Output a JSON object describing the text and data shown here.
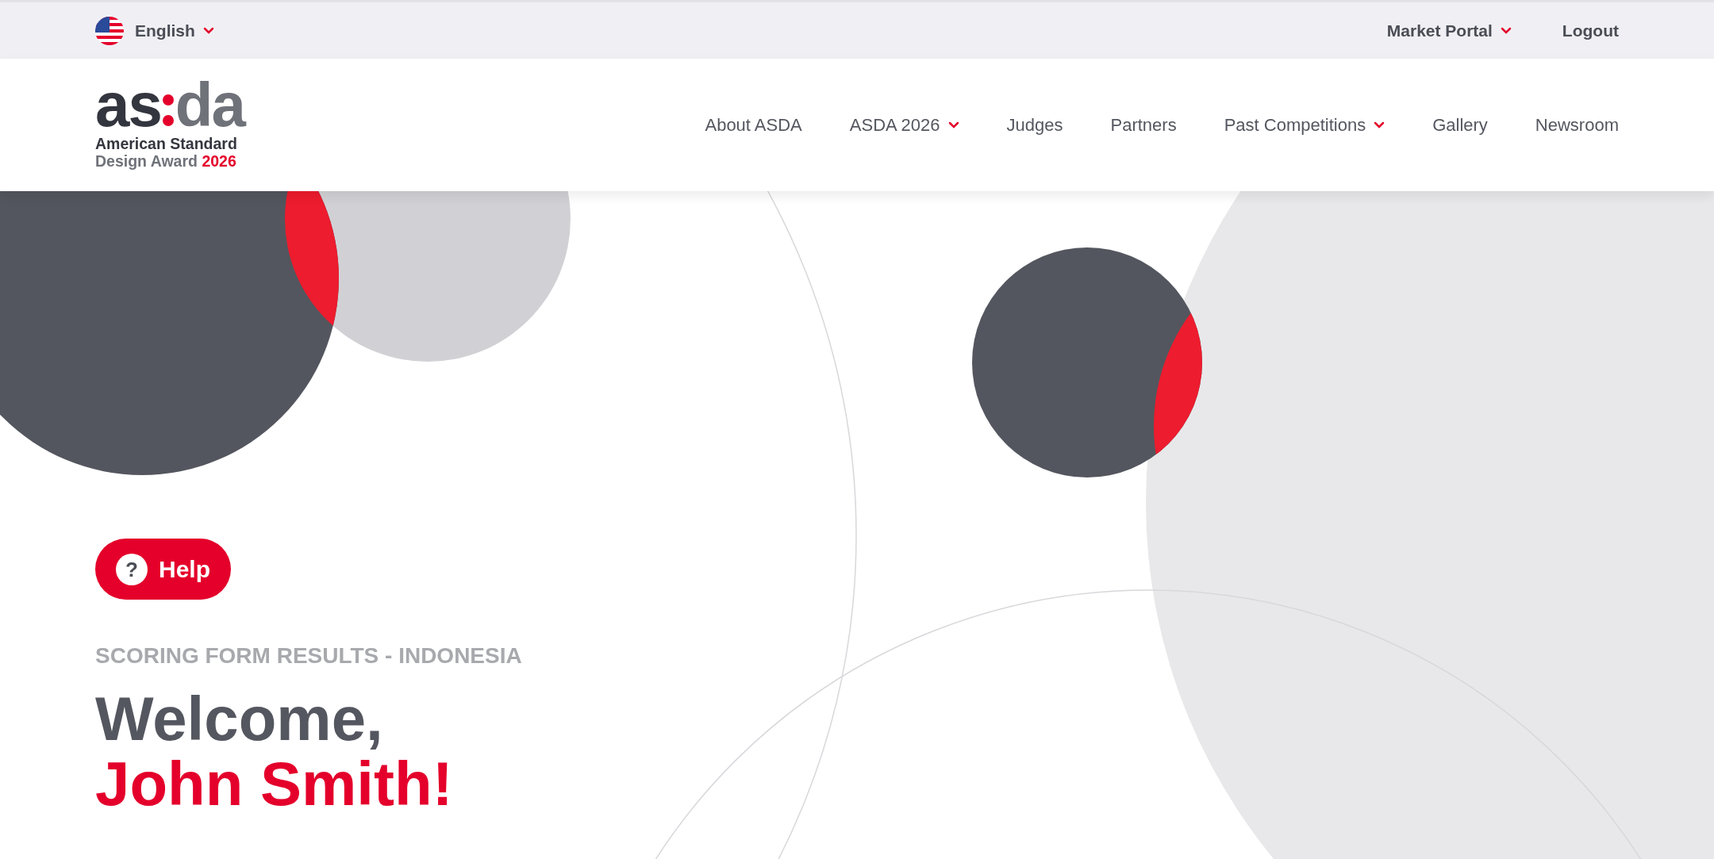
{
  "top_bar": {
    "language": {
      "label": "English",
      "dropdown": true
    },
    "links": [
      {
        "label": "Market Portal",
        "dropdown": true
      },
      {
        "label": "Logout",
        "dropdown": false
      }
    ]
  },
  "logo": {
    "mark_left": "as",
    "mark_right": "da",
    "line1": "American Standard",
    "line2": "Design Award",
    "year": "2026"
  },
  "nav": [
    {
      "label": "About ASDA",
      "dropdown": false
    },
    {
      "label": "ASDA 2026",
      "dropdown": true
    },
    {
      "label": "Judges",
      "dropdown": false
    },
    {
      "label": "Partners",
      "dropdown": false
    },
    {
      "label": "Past Competitions",
      "dropdown": true
    },
    {
      "label": "Gallery",
      "dropdown": false
    },
    {
      "label": "Newsroom",
      "dropdown": false
    }
  ],
  "hero": {
    "help_button": {
      "glyph": "?",
      "label": "Help"
    },
    "eyebrow": "SCORING FORM RESULTS - INDONESIA",
    "welcome": "Welcome,",
    "name": "John Smith!"
  }
}
